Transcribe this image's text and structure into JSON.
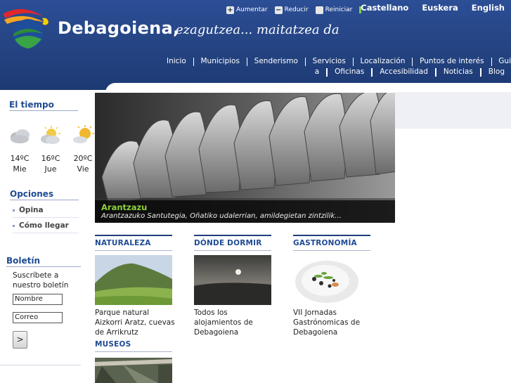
{
  "header": {
    "site_name": "Debagoiena,",
    "slogan": "ezagutzea... maitatzea da",
    "accessibility": [
      {
        "icon": "plus-icon",
        "label": "Aumentar"
      },
      {
        "icon": "minus-icon",
        "label": "Reducir"
      },
      {
        "icon": "reset-icon",
        "label": "Reiniciar"
      }
    ],
    "languages": [
      "Castellano",
      "Euskera",
      "English"
    ],
    "nav_row1": [
      "Inicio",
      "Municipios",
      "Senderismo",
      "Servicios",
      "Localización",
      "Puntos de interés",
      "Gui"
    ],
    "nav_row2": [
      "a",
      "Oficinas",
      "Accesibilidad",
      "Noticias",
      "Blog"
    ]
  },
  "sidebar": {
    "weather": {
      "title": "El tiempo",
      "days": [
        {
          "icon": "cloudy-icon",
          "temp": "14ºC",
          "day": "Mie"
        },
        {
          "icon": "partly-cloudy-icon",
          "temp": "16ºC",
          "day": "Jue"
        },
        {
          "icon": "partly-sunny-icon",
          "temp": "20ºC",
          "day": "Vie"
        }
      ]
    },
    "options": {
      "title": "Opciones",
      "items": [
        "Opina",
        "Cómo llegar"
      ]
    },
    "newsletter": {
      "title": "Boletín",
      "text": "Suscríbete a nuestro boletín",
      "name_value": "Nombre",
      "email_value": "Correo",
      "submit": ">"
    }
  },
  "feature": {
    "title": "Arantzazu",
    "description": "Arantzazuko Santutegia, Oñatiko udalerrian, amildegietan zintzilik..."
  },
  "sections": [
    {
      "title": "NATURALEZA",
      "text": "Parque natural Aizkorri Aratz, cuevas de Arrikrutz"
    },
    {
      "title": "DÓNDE DORMIR",
      "text": "Todos los alojamientos de Debagoiena"
    },
    {
      "title": "GASTRONOMÍA",
      "text": "VII Jornadas Gastrónomicas de Debagoiena"
    },
    {
      "title": "MUSEOS",
      "text": ""
    }
  ],
  "colors": {
    "header_blue": "#23427f",
    "accent_green": "#8cd13a",
    "heading_blue": "#1f4b93"
  }
}
